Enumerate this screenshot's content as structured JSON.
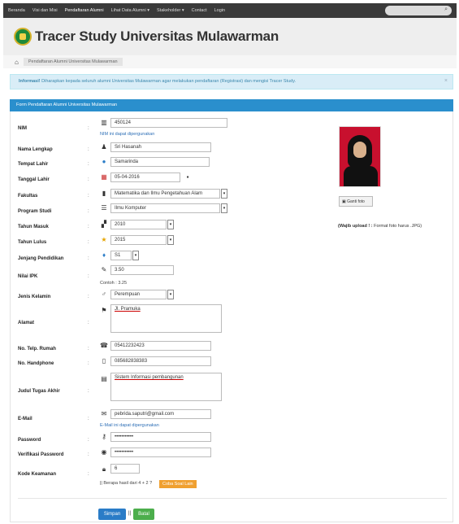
{
  "nav": {
    "items": [
      "Beranda",
      "Visi dan Misi",
      "Pendaftaran Alumni",
      "Lihat Data Alumni  ▾",
      "Stakeholder  ▾",
      "Contact",
      "Login"
    ]
  },
  "header": {
    "title": "Tracer Study Universitas Mulawarman"
  },
  "breadcrumb": {
    "current": "Pendaftaran Alumni Universitas Mulawarman"
  },
  "info": {
    "bold": "Informasi!",
    "text": " Diharapkan kepada seluruh alumni Universitas Mulawarman agar melakukan pendaftaran (Registrasi) dan mengisi Tracer Study."
  },
  "form": {
    "title": "Form Pendaftaran Alumni Universitas Mulawarman",
    "nim": {
      "label": "NIM",
      "value": "450124",
      "hint": "NIM ini dapat dipergunakan"
    },
    "nama": {
      "label": "Nama Lengkap",
      "value": "Sri Hasanah"
    },
    "tempat": {
      "label": "Tempat Lahir",
      "value": "Samarinda"
    },
    "tanggal": {
      "label": "Tanggal Lahir",
      "value": "05-04-2016"
    },
    "fakultas": {
      "label": "Fakultas",
      "value": "Matematika dan Ilmu Pengetahuan Alam"
    },
    "prodi": {
      "label": "Program Studi",
      "value": "Ilmu Komputer"
    },
    "masuk": {
      "label": "Tahun Masuk",
      "value": "2010"
    },
    "lulus": {
      "label": "Tahun Lulus",
      "value": "2015"
    },
    "jenjang": {
      "label": "Jenjang Pendidikan",
      "value": "S1"
    },
    "ipk": {
      "label": "Nilai IPK",
      "value": "3.50",
      "hint": "Contoh : 3.25"
    },
    "kelamin": {
      "label": "Jenis Kelamin",
      "value": "Perempuan"
    },
    "alamat": {
      "label": "Alamat",
      "value": "Jl. Pramuka"
    },
    "telp": {
      "label": "No. Telp. Rumah",
      "value": "05412232423"
    },
    "hp": {
      "label": "No. Handphone",
      "value": "085682838383"
    },
    "judul": {
      "label": "Judul Tugas Akhir",
      "value": "Sistem Informasi pembangunan"
    },
    "email": {
      "label": "E-Mail",
      "value": "pebrida.saputri@gmail.com",
      "hint": "E-Mail ini dapat dipergunakan"
    },
    "password": {
      "label": "Password",
      "value": "•••••••••••"
    },
    "verif": {
      "label": "Verifikasi Password",
      "value": "•••••••••••"
    },
    "kode": {
      "label": "Kode Keamanan",
      "value": "6",
      "question": "|| Berapa hasil dari 4 + 2 ?",
      "retry": "Coba Soal Lain"
    },
    "colon": ":"
  },
  "photo": {
    "button": "Ganti foto",
    "note_bold": "(Wajib upload ! :",
    "note_rest": " Format foto harus .JPG)"
  },
  "actions": {
    "save": "Simpan",
    "pipe": "||",
    "cancel": "Batal"
  }
}
